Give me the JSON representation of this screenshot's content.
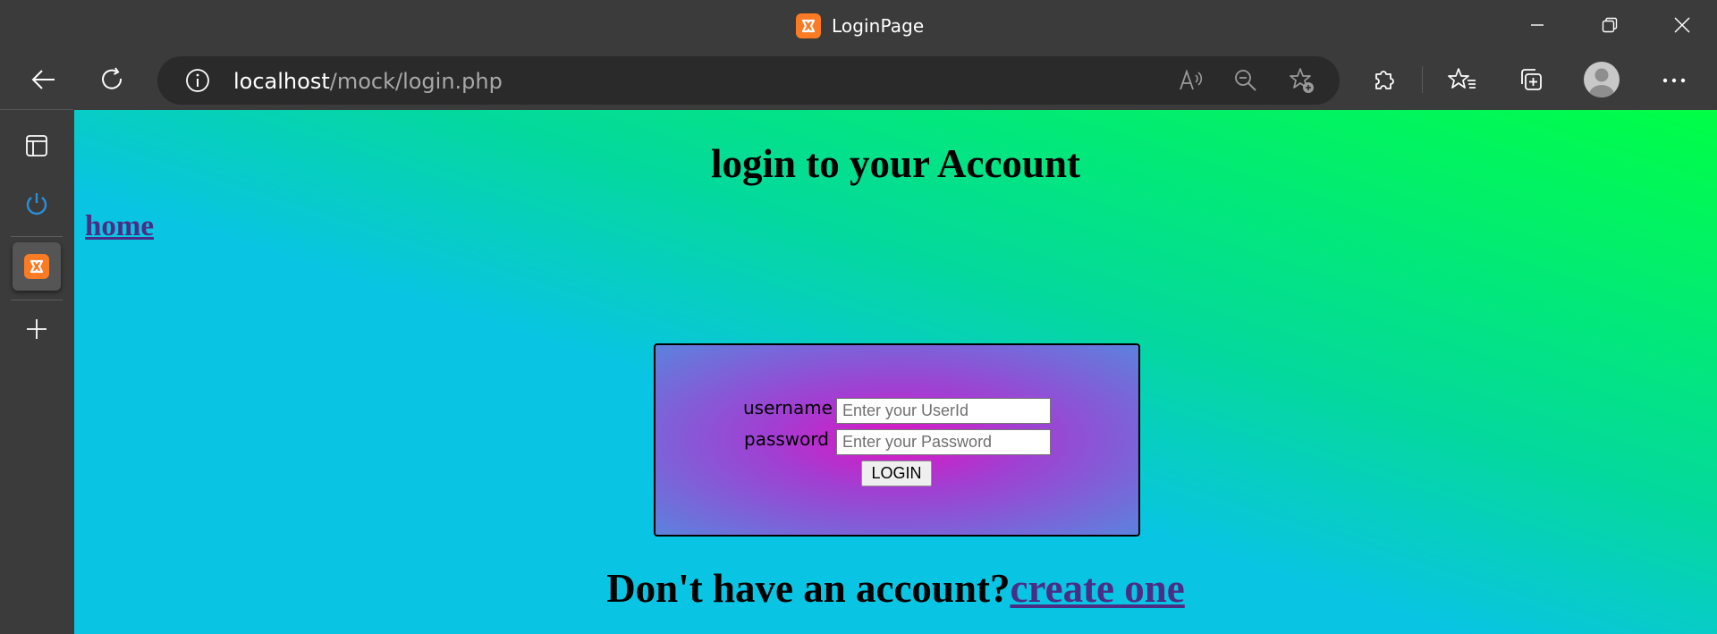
{
  "window": {
    "title": "LoginPage"
  },
  "browser": {
    "url_host": "localhost",
    "url_path": "/mock/login.php"
  },
  "page": {
    "heading": "login to your Account",
    "home_link": "home",
    "form": {
      "username_label": "username",
      "username_placeholder": "Enter your UserId",
      "username_value": "",
      "password_label": "password",
      "password_placeholder": "Enter your Password",
      "password_value": "",
      "login_button": "LOGIN"
    },
    "signup_prompt": "Don't have an account?",
    "signup_link": "create one"
  },
  "colors": {
    "page_gradient": [
      "#09c4e3",
      "#00ff45"
    ],
    "form_gradient": [
      "#de14c4",
      "#5c82dd"
    ],
    "link": "#4b2d86",
    "favicon": "#fb7a24",
    "browser_chrome": "#3b3b3b"
  },
  "icons": {
    "favicon": "xampp-logo-icon",
    "back": "arrow-left-icon",
    "refresh": "refresh-icon",
    "site_info": "info-circle-icon",
    "read_aloud": "read-aloud-icon",
    "zoom_out": "zoom-out-icon",
    "add_favorite": "star-plus-icon",
    "extensions": "puzzle-icon",
    "favorites": "favorites-list-icon",
    "collections": "collections-icon",
    "profile": "user-avatar-icon",
    "more": "ellipsis-icon",
    "tab_actions": "tab-actions-icon",
    "power_app": "power-icon",
    "new_tab": "plus-icon"
  }
}
